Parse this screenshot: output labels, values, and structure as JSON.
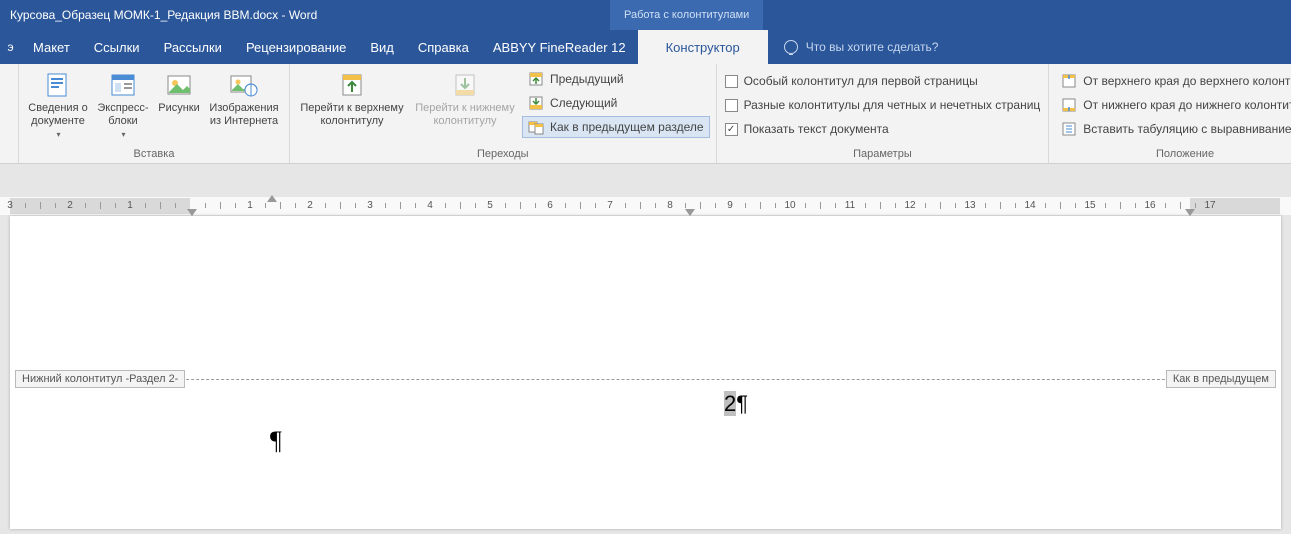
{
  "title": "Курсова_Образец МОМК-1_Редакция BBM.docx  -  Word",
  "contextual_tab": "Работа с колонтитулами",
  "tabs": {
    "t0_partial": "э",
    "layout": "Макет",
    "links": "Ссылки",
    "mailings": "Рассылки",
    "review": "Рецензирование",
    "view": "Вид",
    "help": "Справка",
    "abbyy": "ABBYY FineReader 12",
    "design": "Конструктор"
  },
  "tell_me": "Что вы хотите сделать?",
  "groups": {
    "insert": {
      "label": "Вставка",
      "doc_info": "Сведения о документе",
      "quick_parts": "Экспресс-блоки",
      "pictures": "Рисунки",
      "online_pics": "Изображения из Интернета"
    },
    "navigation": {
      "label": "Переходы",
      "goto_header": "Перейти к верхнему колонтитулу",
      "goto_footer": "Перейти к нижнему колонтитулу",
      "previous": "Предыдущий",
      "next": "Следующий",
      "link_prev": "Как в предыдущем разделе"
    },
    "options": {
      "label": "Параметры",
      "diff_first": "Особый колонтитул для первой страницы",
      "diff_odd_even": "Разные колонтитулы для четных и нечетных страниц",
      "show_doc": "Показать текст документа",
      "show_doc_checked": true
    },
    "position": {
      "label": "Положение",
      "from_top": "От верхнего края до верхнего колонтиту",
      "from_bottom": "От нижнего края до нижнего колонтиту",
      "insert_tab": "Вставить табуляцию с выравниванием"
    }
  },
  "ruler": {
    "labels": [
      "3",
      "2",
      "1",
      "1",
      "2",
      "3",
      "4",
      "5",
      "6",
      "7",
      "8",
      "9",
      "10",
      "11",
      "12",
      "13",
      "14",
      "15",
      "16",
      "17"
    ]
  },
  "document": {
    "footer_label_left": "Нижний колонтитул -Раздел 2-",
    "footer_label_right": "Как в предыдущем",
    "page_number": "2",
    "pilcrow": "¶"
  }
}
